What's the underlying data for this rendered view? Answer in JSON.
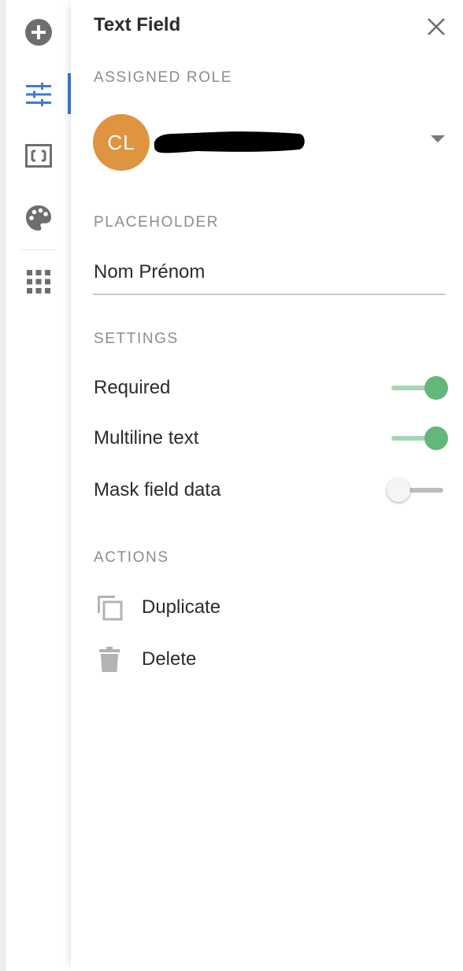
{
  "panel": {
    "title": "Text Field",
    "close_icon": "close-icon"
  },
  "rail": {
    "items": [
      {
        "name": "add",
        "icon": "plus-circle-icon"
      },
      {
        "name": "settings",
        "icon": "sliders-icon",
        "active": true
      },
      {
        "name": "layout",
        "icon": "frame-brackets-icon"
      },
      {
        "name": "style",
        "icon": "palette-icon"
      },
      {
        "name": "apps",
        "icon": "grid-icon"
      }
    ],
    "accent": "#3f7ad6"
  },
  "assigned_role": {
    "label": "ASSIGNED ROLE",
    "avatar_initials": "CL",
    "avatar_color": "#df9440",
    "name_redacted": true
  },
  "placeholder": {
    "label": "PLACEHOLDER",
    "value": "Nom Prénom"
  },
  "settings": {
    "label": "SETTINGS",
    "items": [
      {
        "label": "Required",
        "on": true
      },
      {
        "label": "Multiline text",
        "on": true
      },
      {
        "label": "Mask field data",
        "on": false
      }
    ],
    "toggle_on_color": "#63b77a"
  },
  "actions": {
    "label": "ACTIONS",
    "items": [
      {
        "label": "Duplicate",
        "icon": "duplicate-icon"
      },
      {
        "label": "Delete",
        "icon": "trash-icon"
      }
    ]
  }
}
